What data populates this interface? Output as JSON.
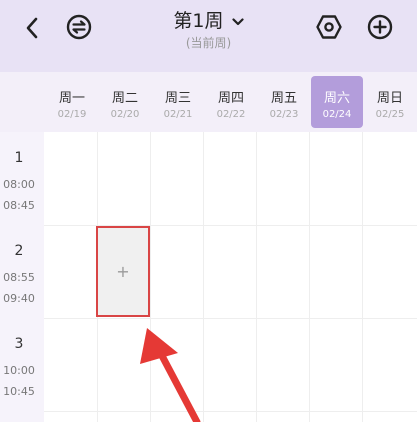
{
  "header": {
    "week_title": "第1周",
    "week_subtitle": "(当前周)",
    "icons": [
      "back-icon",
      "switch-icon",
      "settings-icon",
      "add-icon"
    ]
  },
  "days": [
    {
      "name": "周一",
      "date": "02/19",
      "active": false
    },
    {
      "name": "周二",
      "date": "02/20",
      "active": false
    },
    {
      "name": "周三",
      "date": "02/21",
      "active": false
    },
    {
      "name": "周四",
      "date": "02/22",
      "active": false
    },
    {
      "name": "周五",
      "date": "02/23",
      "active": false
    },
    {
      "name": "周六",
      "date": "02/24",
      "active": true
    },
    {
      "name": "周日",
      "date": "02/25",
      "active": false
    }
  ],
  "slots": [
    {
      "num": "1",
      "start": "08:00",
      "end": "08:45"
    },
    {
      "num": "2",
      "start": "08:55",
      "end": "09:40"
    },
    {
      "num": "3",
      "start": "10:00",
      "end": "10:45"
    }
  ],
  "add_cell": {
    "symbol": "+"
  },
  "colors": {
    "header_bg": "#e8e2f5",
    "active_day": "#b39ddb",
    "highlight_border": "#d94545",
    "annotation_arrow": "#e53935"
  }
}
